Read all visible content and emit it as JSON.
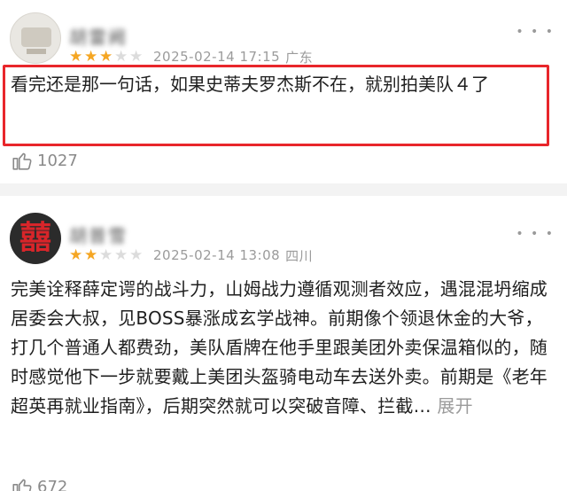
{
  "comments": [
    {
      "username": "胡雷阙",
      "rating": 3,
      "timestamp": "2025-02-14 17:15",
      "location": "广东",
      "text": "看完还是那一句话，如果史蒂夫罗杰斯不在，就别拍美队４了",
      "likes": "1027",
      "more_label": "• • •"
    },
    {
      "username": "胡普雪",
      "rating": 2,
      "timestamp": "2025-02-14 13:08",
      "location": "四川",
      "text": "完美诠释薛定谔的战斗力，山姆战力遵循观测者效应，遇混混坍缩成居委会大叔，见BOSS暴涨成玄学战神。前期像个领退休金的大爷，打几个普通人都费劲，美队盾牌在他手里跟美团外卖保温箱似的，随时感觉他下一步就要戴上美团头盔骑电动车去送外卖。前期是《老年超英再就业指南》，后期突然就可以突破音障、拦截…",
      "expand_label": "展开",
      "likes": "672",
      "more_label": "• • •",
      "avatar_char": "囍"
    }
  ],
  "colors": {
    "star_on": "#f5a623",
    "star_off": "#dcdcdc",
    "highlight": "#e8262b",
    "meta": "#9b9b9b"
  },
  "icons": [
    "thumbs-up-icon",
    "more-dots-icon",
    "star-icon"
  ]
}
